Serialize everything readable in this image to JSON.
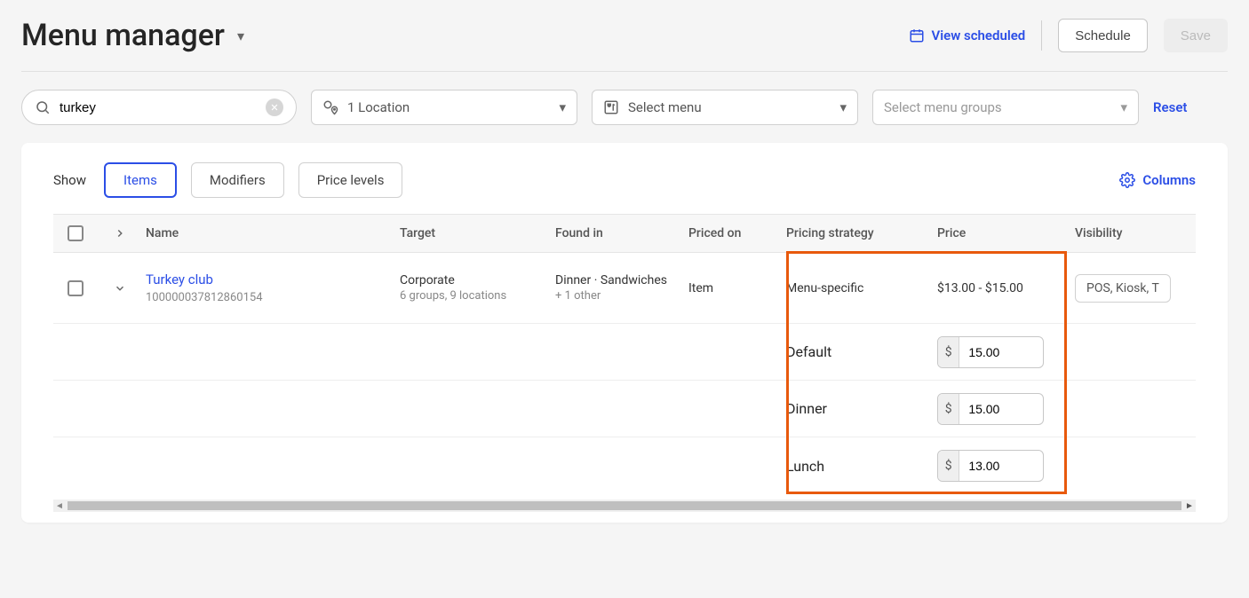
{
  "header": {
    "title": "Menu manager",
    "view_scheduled": "View scheduled",
    "schedule": "Schedule",
    "save": "Save"
  },
  "filters": {
    "search_value": "turkey",
    "location_label": "1 Location",
    "menu_placeholder": "Select menu",
    "groups_placeholder": "Select menu groups",
    "reset": "Reset"
  },
  "tabs": {
    "show": "Show",
    "items": "Items",
    "modifiers": "Modifiers",
    "price_levels": "Price levels",
    "columns": "Columns"
  },
  "columns": {
    "name": "Name",
    "target": "Target",
    "found_in": "Found in",
    "priced_on": "Priced on",
    "pricing_strategy": "Pricing strategy",
    "price": "Price",
    "visibility": "Visibility"
  },
  "row": {
    "name": "Turkey club",
    "id": "100000037812860154",
    "target": "Corporate",
    "target_sub": "6 groups, 9 locations",
    "found_in": "Dinner · Sandwiches",
    "found_in_sub": "+ 1 other",
    "priced_on": "Item",
    "strategy": "Menu-specific",
    "price_range": "$13.00 - $15.00",
    "visibility": "POS, Kiosk, T"
  },
  "price_levels": [
    {
      "label": "Default",
      "value": "15.00"
    },
    {
      "label": "Dinner",
      "value": "15.00"
    },
    {
      "label": "Lunch",
      "value": "13.00"
    }
  ]
}
